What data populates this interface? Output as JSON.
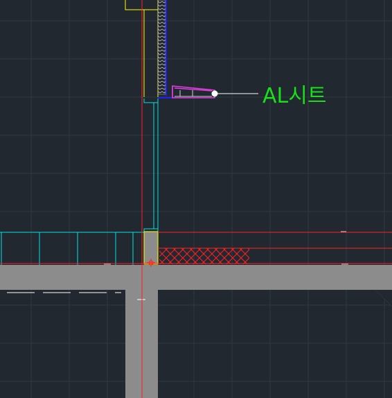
{
  "viewport": {
    "background": "#212830",
    "grid_color": "#2f3742"
  },
  "annotation": {
    "label": "AL시트",
    "color": "#19e019"
  },
  "layer_colors": {
    "structure": "#8c8c8c",
    "outline": "#ffffff",
    "centerline": "#ff2020",
    "window_frame": "#00e5e5",
    "finish": "#ffff00",
    "insulation": "#bfbfbf",
    "sheet": "#e040e0",
    "blue_detail": "#2020ff",
    "hatch": "#ff2020"
  }
}
